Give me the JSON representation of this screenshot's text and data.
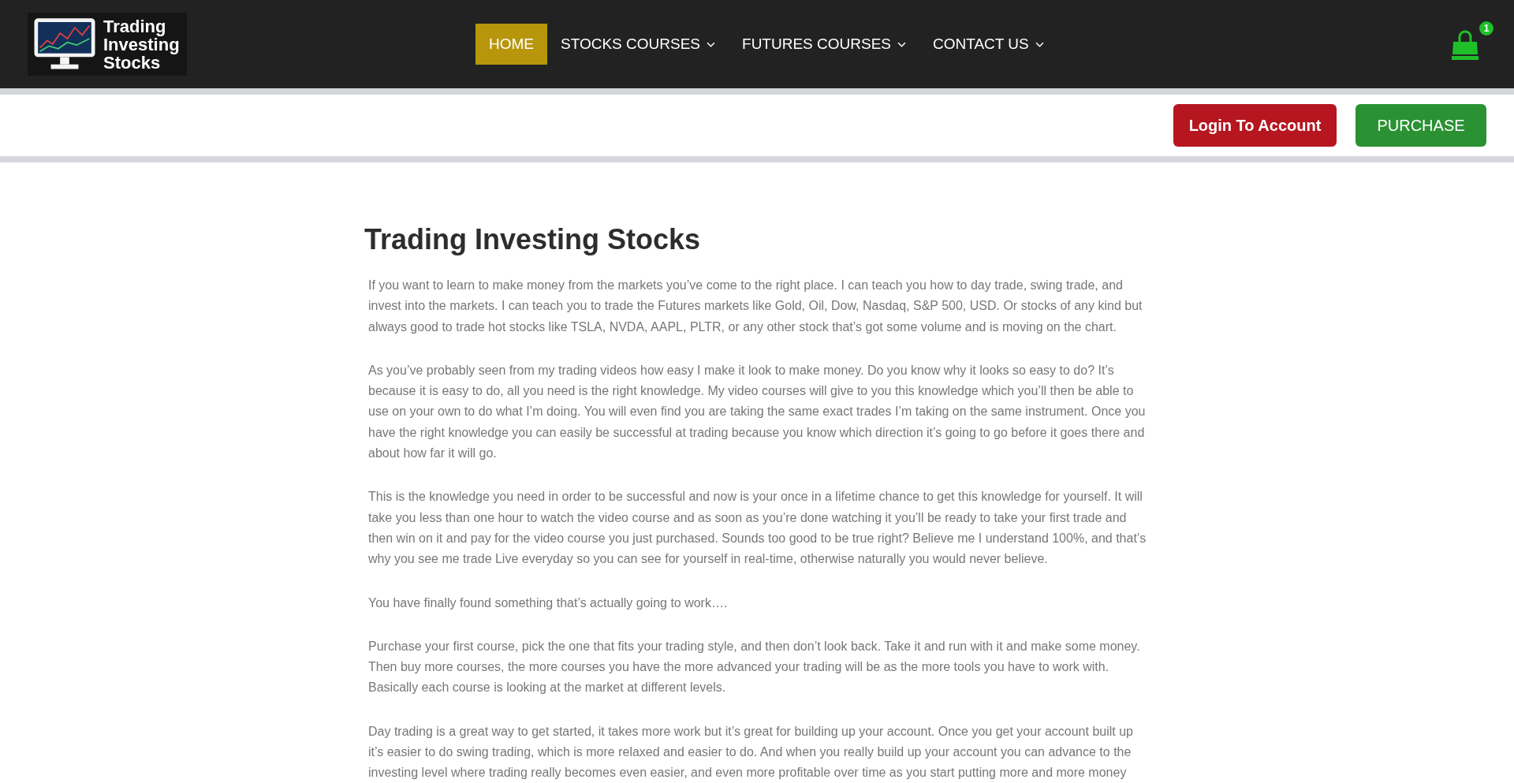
{
  "header": {
    "logo": {
      "lines": [
        "Trading",
        "Investing",
        "Stocks"
      ]
    },
    "nav": [
      {
        "label": "HOME",
        "selected": true,
        "has_menu": false
      },
      {
        "label": "STOCKS COURSES",
        "selected": false,
        "has_menu": true
      },
      {
        "label": "FUTURES COURSES",
        "selected": false,
        "has_menu": true
      },
      {
        "label": "CONTACT US",
        "selected": false,
        "has_menu": true
      }
    ],
    "cart": {
      "count": "1"
    }
  },
  "action_bar": {
    "buttons": [
      {
        "label": "Login To Account",
        "kind": "login"
      },
      {
        "label": "PURCHASE",
        "kind": "purchase"
      }
    ]
  },
  "article": {
    "title": "Trading Investing Stocks",
    "paragraphs": [
      "If you want to learn to make money from the markets you’ve come to the right place. I can teach you how to day trade, swing trade, and invest into the markets. I can teach you to trade the Futures markets like Gold, Oil, Dow, Nasdaq, S&P 500, USD. Or stocks of any kind but always good to trade hot stocks like TSLA, NVDA, AAPL, PLTR, or any other stock that’s got some volume and is moving on the chart.",
      "As you’ve probably seen from my trading videos how easy I make it look to make money. Do you know why it looks so easy to do? It’s because it is easy to do, all you need is the right knowledge. My video courses will give to you this knowledge which you’ll then be able to use on your own to do what I’m doing. You will even find you are taking the same exact trades I’m taking on the same instrument. Once you have the right knowledge you can easily be successful at trading because you know which direction it’s going to go before it goes there and about how far it will go.",
      "This is the knowledge you need in order to be successful and now is your once in a lifetime chance to get this knowledge for yourself. It will take you less than one hour to watch the video course and as soon as you’re done watching it you’ll be ready to take your first trade and then win on it and pay for the video course you just purchased. Sounds too good to be true right? Believe me I understand 100%, and that’s why you see me trade Live everyday so you can see for yourself in real-time, otherwise naturally you would never believe.",
      "You have finally found something that’s actually going to work….",
      "Purchase your first course, pick the one that fits your trading style, and then don’t look back. Take it and run with it and make some money. Then buy more courses, the more courses you have the more advanced your trading will be as the more tools you have to work with. Basically each course is looking at the market at different levels.",
      "Day trading is a great way to get started, it takes more work but it’s great for building up your account. Once you get your account built up it’s easier to do swing trading, which is more relaxed and easier to do. And when you really build up your account you can advance to the investing level where trading really becomes even easier, and even more profitable over time as you start putting more and more money"
    ]
  }
}
